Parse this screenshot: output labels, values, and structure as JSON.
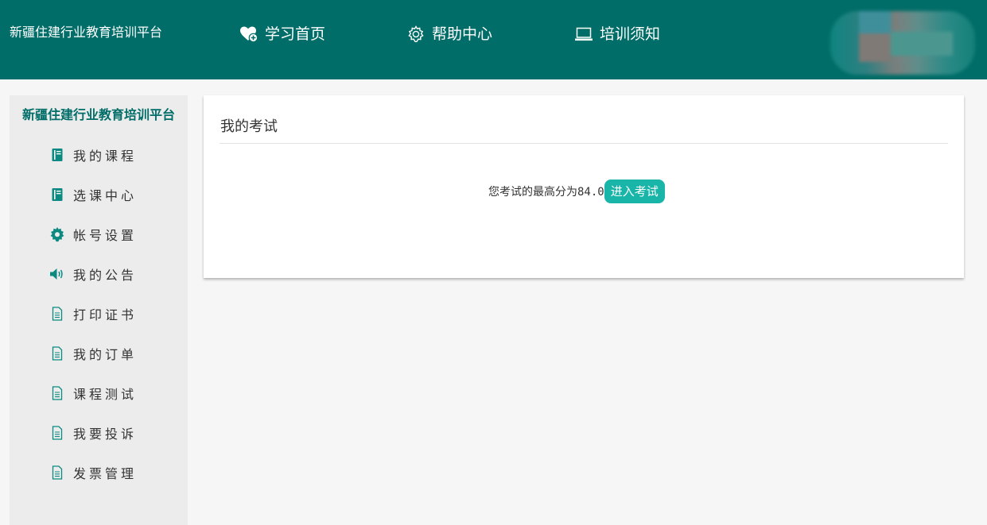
{
  "header": {
    "site_title": "新疆住建行业教育培训平台",
    "nav": [
      {
        "label": "学习首页",
        "icon": "heart-plus-icon"
      },
      {
        "label": "帮助中心",
        "icon": "gear-outline-icon"
      },
      {
        "label": "培训须知",
        "icon": "laptop-icon"
      }
    ],
    "avatar_icon": "blurred-user-avatar"
  },
  "sidebar": {
    "title": "新疆住建行业教育培训平台",
    "items": [
      {
        "label": "我的课程",
        "icon": "book-icon"
      },
      {
        "label": "选课中心",
        "icon": "book-icon"
      },
      {
        "label": "帐号设置",
        "icon": "gear-icon"
      },
      {
        "label": "我的公告",
        "icon": "speaker-icon"
      },
      {
        "label": "打印证书",
        "icon": "document-icon"
      },
      {
        "label": "我的订单",
        "icon": "document-icon"
      },
      {
        "label": "课程测试",
        "icon": "document-icon"
      },
      {
        "label": "我要投诉",
        "icon": "document-icon"
      },
      {
        "label": "发票管理",
        "icon": "document-icon"
      }
    ]
  },
  "main": {
    "panel_title": "我的考试",
    "score_text": "您考试的最高分为84.0",
    "enter_button": "进入考试"
  },
  "colors": {
    "header_bg": "#006d68",
    "accent": "#18b5a8",
    "sidebar_bg": "#ececec",
    "page_bg": "#f6f6f6"
  }
}
